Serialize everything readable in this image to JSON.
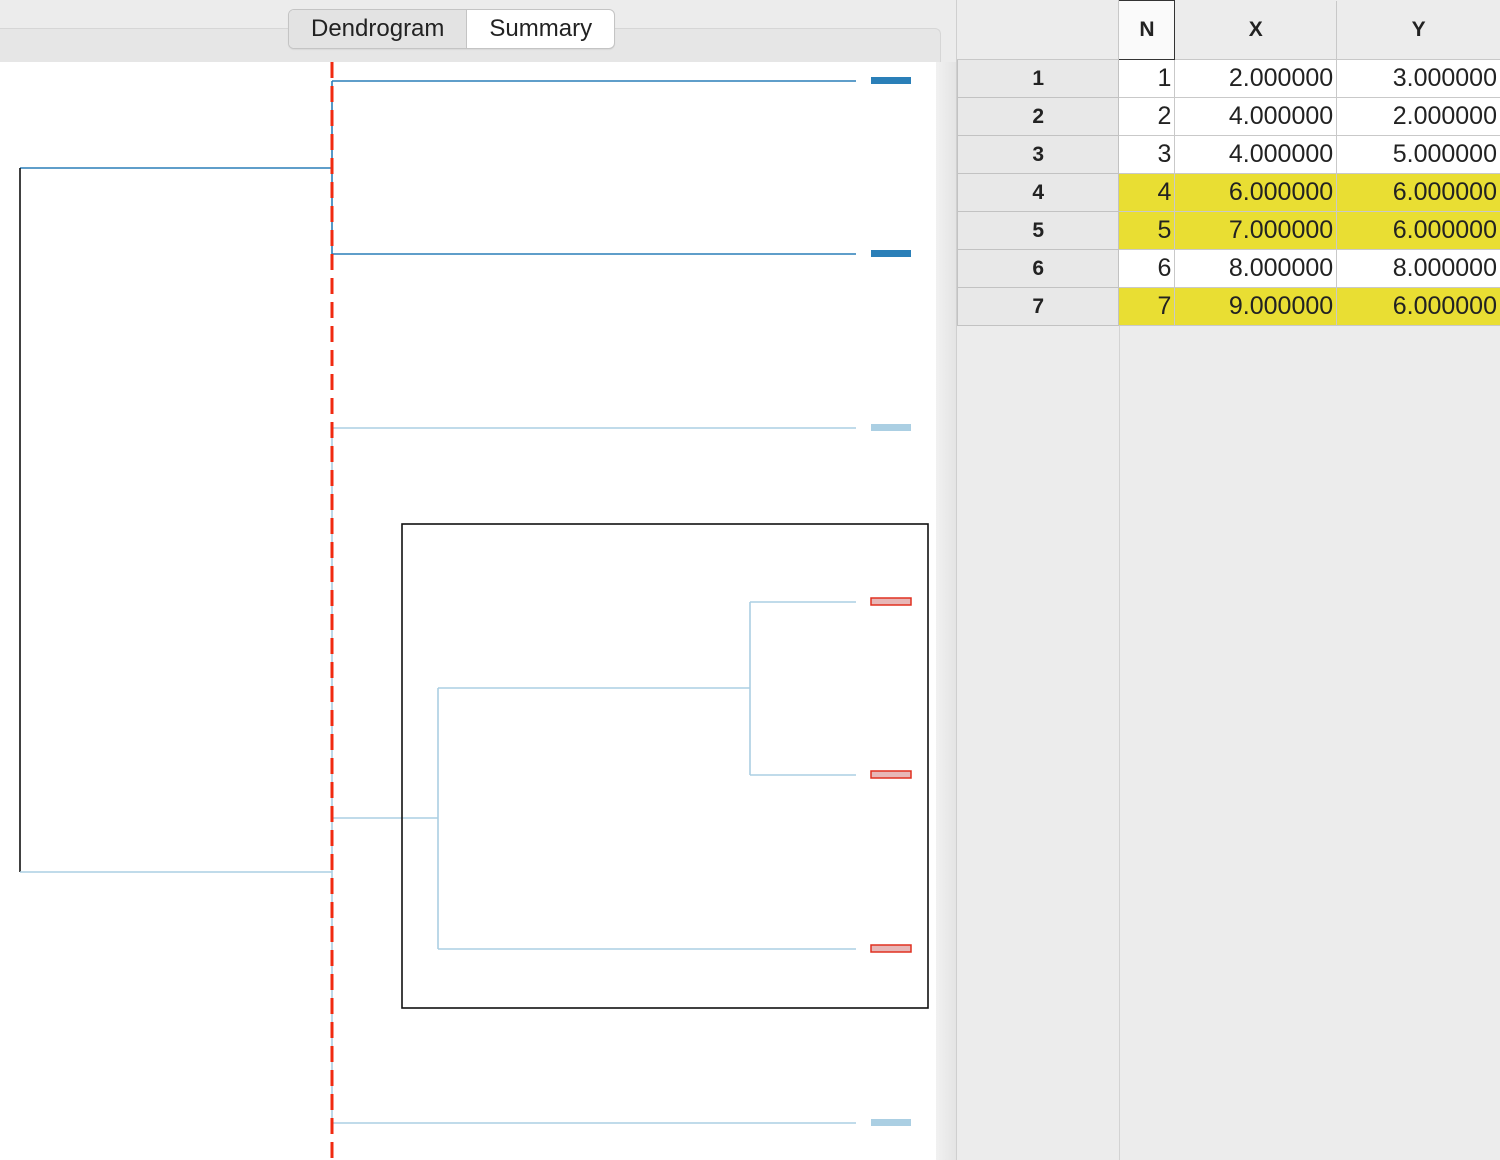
{
  "tabs": [
    {
      "label": "Dendrogram",
      "active": true
    },
    {
      "label": "Summary",
      "active": false
    }
  ],
  "dendrogram": {
    "leaf_colors": {
      "dark_blue": "#2a7fb8",
      "light_blue": "#abcfe3",
      "selected": "#e7b7b7",
      "selected_outline": "#e03020"
    },
    "cut_line_color": "#f02a10",
    "selection_box": true
  },
  "table": {
    "columns": [
      "",
      "N",
      "X",
      "Y"
    ],
    "rows": [
      {
        "row": "1",
        "N": "1",
        "X": "2.000000",
        "Y": "3.000000",
        "highlight": false
      },
      {
        "row": "2",
        "N": "2",
        "X": "4.000000",
        "Y": "2.000000",
        "highlight": false
      },
      {
        "row": "3",
        "N": "3",
        "X": "4.000000",
        "Y": "5.000000",
        "highlight": false
      },
      {
        "row": "4",
        "N": "4",
        "X": "6.000000",
        "Y": "6.000000",
        "highlight": true
      },
      {
        "row": "5",
        "N": "5",
        "X": "7.000000",
        "Y": "6.000000",
        "highlight": true
      },
      {
        "row": "6",
        "N": "6",
        "X": "8.000000",
        "Y": "8.000000",
        "highlight": false
      },
      {
        "row": "7",
        "N": "7",
        "X": "9.000000",
        "Y": "6.000000",
        "highlight": true
      }
    ],
    "highlight_color": "#e9de33"
  }
}
